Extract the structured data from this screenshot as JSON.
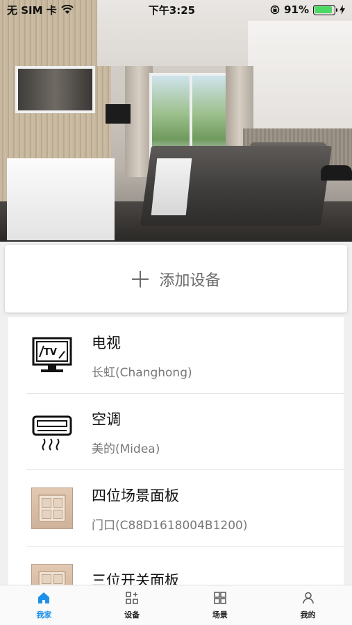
{
  "status_bar": {
    "carrier": "无 SIM 卡",
    "time": "下午3:25",
    "battery": "91%",
    "battery_level": 0.91
  },
  "add_device": {
    "label": "添加设备",
    "icon": "plus-icon"
  },
  "devices": [
    {
      "name": "电视",
      "sub": "长虹(Changhong)",
      "icon": "tv-icon"
    },
    {
      "name": "空调",
      "sub": "美的(Midea)",
      "icon": "air-conditioner-icon"
    },
    {
      "name": "四位场景面板",
      "sub": "门口(C88D1618004B1200)",
      "icon": "scene-panel-icon"
    },
    {
      "name": "三位开关面板",
      "sub": "",
      "icon": "switch-panel-icon"
    }
  ],
  "tabs": [
    {
      "label": "我家",
      "icon": "home-icon",
      "active": true
    },
    {
      "label": "设备",
      "icon": "device-icon",
      "active": false
    },
    {
      "label": "场景",
      "icon": "scene-icon",
      "active": false
    },
    {
      "label": "我的",
      "icon": "user-icon",
      "active": false
    }
  ],
  "colors": {
    "accent": "#1e90e8",
    "battery": "#4cd964"
  }
}
